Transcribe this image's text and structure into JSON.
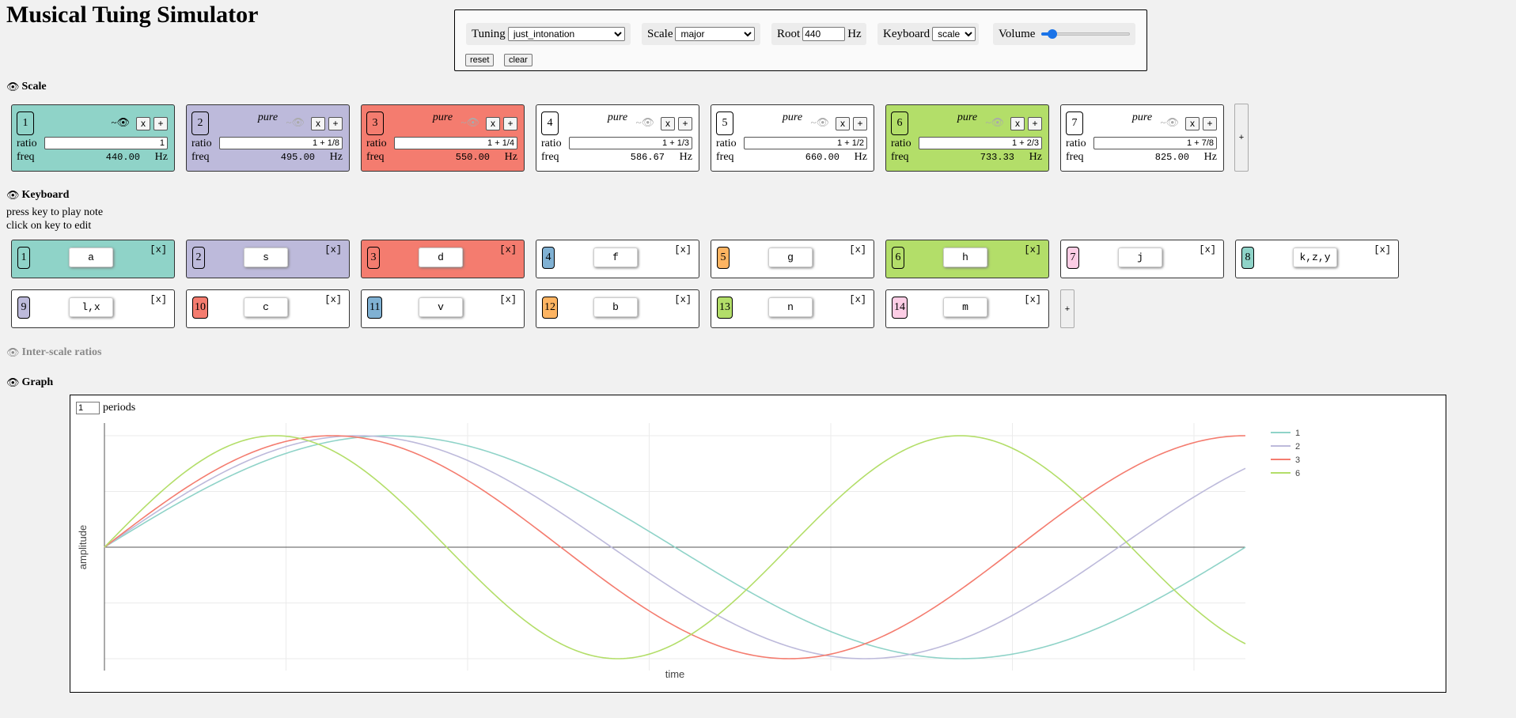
{
  "app": {
    "title": "Musical Tuing Simulator"
  },
  "controls": {
    "tuning_label": "Tuning",
    "tuning_value": "just_intonation",
    "scale_label": "Scale",
    "scale_value": "major",
    "root_label": "Root",
    "root_value": "440",
    "root_unit": "Hz",
    "keyboard_label": "Keyboard",
    "keyboard_value": "scale",
    "volume_label": "Volume",
    "volume_level": 0.12,
    "reset_label": "reset",
    "clear_label": "clear"
  },
  "sections": {
    "scale": "Scale",
    "keyboard": "Keyboard",
    "inter_scale": "Inter-scale ratios",
    "graph": "Graph"
  },
  "scale": {
    "ratio_label": "ratio",
    "freq_label": "freq",
    "hz": "Hz",
    "pure": "pure",
    "remove": "x",
    "add": "+",
    "notes": [
      {
        "num": "1",
        "ratio": "1",
        "freq": "440.00",
        "color": "#8fd3c8",
        "pure": false,
        "visible": true
      },
      {
        "num": "2",
        "ratio": "1 + 1/8",
        "freq": "495.00",
        "color": "#bdbadb",
        "pure": true,
        "visible": false
      },
      {
        "num": "3",
        "ratio": "1 + 1/4",
        "freq": "550.00",
        "color": "#f47c6f",
        "pure": true,
        "visible": false
      },
      {
        "num": "4",
        "ratio": "1 + 1/3",
        "freq": "586.67",
        "color": "#ffffff",
        "pure": true,
        "visible": false
      },
      {
        "num": "5",
        "ratio": "1 + 1/2",
        "freq": "660.00",
        "color": "#ffffff",
        "pure": true,
        "visible": false
      },
      {
        "num": "6",
        "ratio": "1 + 2/3",
        "freq": "733.33",
        "color": "#b3de69",
        "pure": true,
        "visible": false
      },
      {
        "num": "7",
        "ratio": "1 + 7/8",
        "freq": "825.00",
        "color": "#ffffff",
        "pure": true,
        "visible": false
      }
    ],
    "add_note": "+"
  },
  "keyboard": {
    "hint1": "press key to play note",
    "hint2": "click on key to edit",
    "remove": "[x]",
    "keys": [
      {
        "num": "1",
        "key": "a",
        "bg": "#8fd3c8",
        "numbg": "#8fd3c8"
      },
      {
        "num": "2",
        "key": "s",
        "bg": "#bdbadb",
        "numbg": "#bdbadb"
      },
      {
        "num": "3",
        "key": "d",
        "bg": "#f47c6f",
        "numbg": "#f47c6f"
      },
      {
        "num": "4",
        "key": "f",
        "bg": "#ffffff",
        "numbg": "#80b1d3"
      },
      {
        "num": "5",
        "key": "g",
        "bg": "#ffffff",
        "numbg": "#fdb462"
      },
      {
        "num": "6",
        "key": "h",
        "bg": "#b3de69",
        "numbg": "#b3de69"
      },
      {
        "num": "7",
        "key": "j",
        "bg": "#ffffff",
        "numbg": "#fccde5"
      },
      {
        "num": "8",
        "key": "k,z,y",
        "bg": "#ffffff",
        "numbg": "#8fd3c8"
      },
      {
        "num": "9",
        "key": "l,x",
        "bg": "#ffffff",
        "numbg": "#bdbadb"
      },
      {
        "num": "10",
        "key": "c",
        "bg": "#ffffff",
        "numbg": "#f47c6f"
      },
      {
        "num": "11",
        "key": "v",
        "bg": "#ffffff",
        "numbg": "#80b1d3"
      },
      {
        "num": "12",
        "key": "b",
        "bg": "#ffffff",
        "numbg": "#fdb462"
      },
      {
        "num": "13",
        "key": "n",
        "bg": "#ffffff",
        "numbg": "#b3de69"
      },
      {
        "num": "14",
        "key": "m",
        "bg": "#ffffff",
        "numbg": "#fccde5"
      }
    ],
    "add_key": "+"
  },
  "graph": {
    "periods_value": "1",
    "periods_label": "periods"
  },
  "chart_data": {
    "type": "line",
    "xlabel": "time",
    "ylabel": "amplitude",
    "x_range": [
      0,
      1
    ],
    "ylim": [
      -1,
      1
    ],
    "grid": true,
    "legend_position": "top-right",
    "series": [
      {
        "name": "1",
        "ratio": 1,
        "color": "#8fd3c8"
      },
      {
        "name": "2",
        "ratio": 1.125,
        "color": "#bdbadb"
      },
      {
        "name": "3",
        "ratio": 1.25,
        "color": "#f47c6f"
      },
      {
        "name": "6",
        "ratio": 1.6667,
        "color": "#b3de69"
      }
    ]
  }
}
